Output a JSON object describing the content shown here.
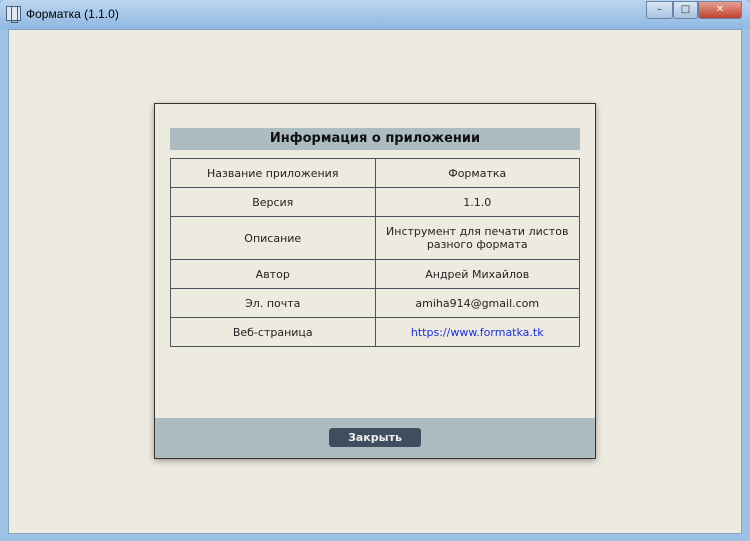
{
  "window": {
    "title": "Форматка (1.1.0)",
    "minimize": "–",
    "maximize": "□",
    "close": "✕"
  },
  "dialog": {
    "heading": "Информация о приложении",
    "rows": [
      {
        "label": "Название приложения",
        "value": "Форматка"
      },
      {
        "label": "Версия",
        "value": "1.1.0"
      },
      {
        "label": "Описание",
        "value": "Инструмент для печати листов разного формата"
      },
      {
        "label": "Автор",
        "value": "Андрей Михайлов"
      },
      {
        "label": "Эл. почта",
        "value": "amiha914@gmail.com"
      },
      {
        "label": "Веб-страница",
        "value": "https://www.formatka.tk"
      }
    ],
    "close_label": "Закрыть"
  }
}
